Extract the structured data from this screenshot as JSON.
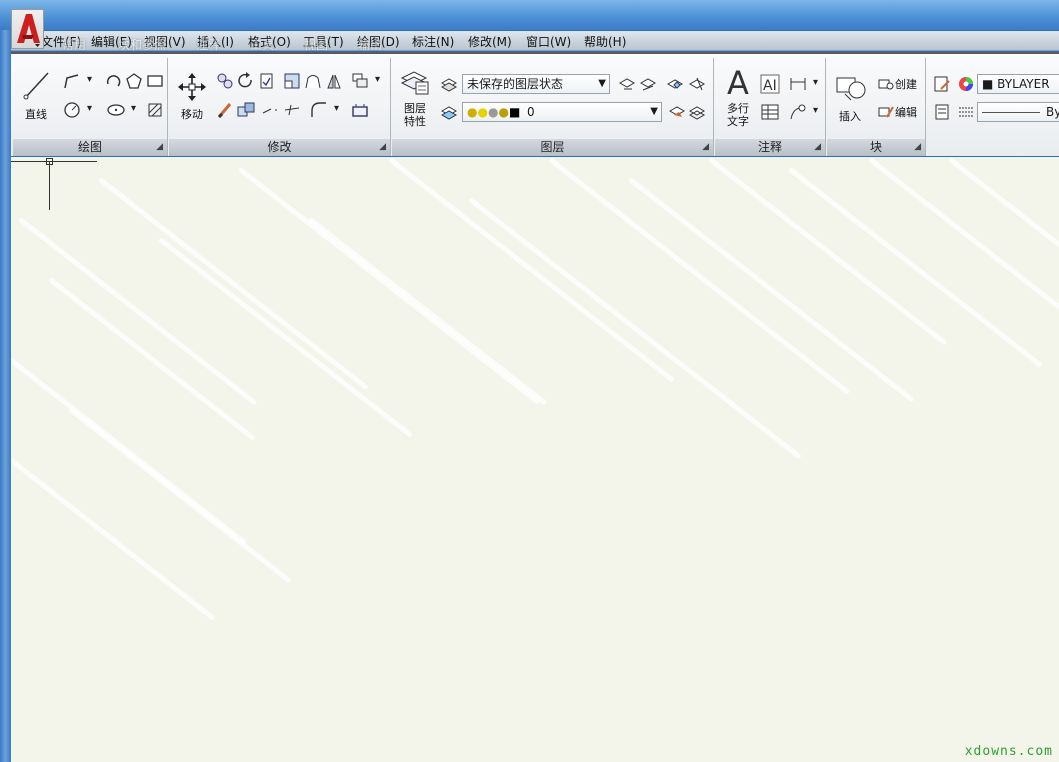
{
  "menu": [
    "文件(F)",
    "编辑(E)",
    "视图(V)",
    "插入(I)",
    "格式(O)",
    "工具(T)",
    "绘图(D)",
    "标注(N)",
    "修改(M)",
    "窗口(W)",
    "帮助(H)"
  ],
  "ghost_tabs": [
    "常用",
    "块和参照",
    "注释",
    "工具",
    "视图",
    "输出"
  ],
  "panels": {
    "draw": {
      "title": "绘图",
      "line_label": "直线"
    },
    "modify": {
      "title": "修改",
      "move_label": "移动"
    },
    "layers": {
      "title": "图层",
      "props_label": "图层\n特性",
      "layer_state": "未保存的图层状态",
      "current_layer": "0"
    },
    "annotation": {
      "title": "注释",
      "mtext_label": "多行\n文字"
    },
    "block": {
      "title": "块",
      "insert_label": "插入",
      "create_label": "创建",
      "edit_label": "编辑"
    },
    "properties": {
      "color_value": "BYLAYER",
      "linetype_value": "By"
    }
  },
  "colors": {
    "accent": "#cc1f1f",
    "canvas": "#f3f5ea",
    "watermark": "#2f9e2f"
  },
  "watermark": "xdowns.com"
}
